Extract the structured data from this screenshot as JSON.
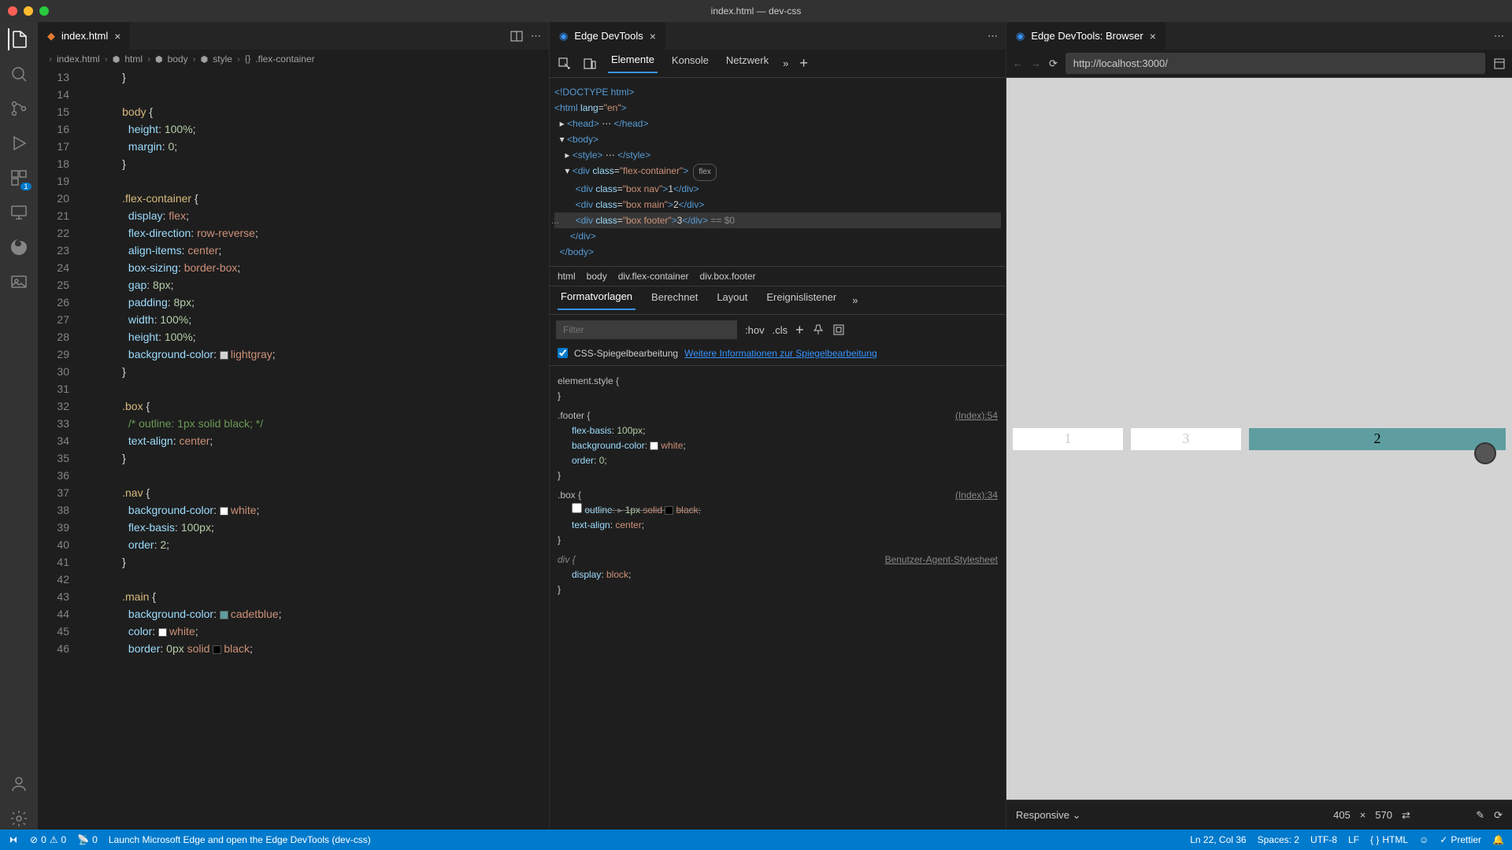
{
  "window": {
    "title": "index.html — dev-css"
  },
  "activity": {
    "badge": "1"
  },
  "editor": {
    "tab": "index.html",
    "breadcrumb": [
      "index.html",
      "html",
      "body",
      "style",
      ".flex-container"
    ],
    "lines": [
      {
        "n": 13,
        "html": "        <span class='punc'>}</span>"
      },
      {
        "n": 14,
        "html": ""
      },
      {
        "n": 15,
        "html": "        <span class='sel'>body</span> <span class='punc'>{</span>"
      },
      {
        "n": 16,
        "html": "          <span class='prop'>height</span>: <span class='num'>100%</span>;"
      },
      {
        "n": 17,
        "html": "          <span class='prop'>margin</span>: <span class='num'>0</span>;"
      },
      {
        "n": 18,
        "html": "        <span class='punc'>}</span>"
      },
      {
        "n": 19,
        "html": ""
      },
      {
        "n": 20,
        "html": "        <span class='sel'>.flex-container</span> <span class='punc'>{</span>"
      },
      {
        "n": 21,
        "html": "          <span class='prop'>display</span>: <span class='val'>flex</span>;"
      },
      {
        "n": 22,
        "html": "          <span class='prop'>flex-direction</span>: <span class='val'>row-reverse</span>;"
      },
      {
        "n": 23,
        "html": "          <span class='prop'>align-items</span>: <span class='val'>center</span>;"
      },
      {
        "n": 24,
        "html": "          <span class='prop'>box-sizing</span>: <span class='val'>border-box</span>;"
      },
      {
        "n": 25,
        "html": "          <span class='prop'>gap</span>: <span class='num'>8px</span>;"
      },
      {
        "n": 26,
        "html": "          <span class='prop'>padding</span>: <span class='num'>8px</span>;"
      },
      {
        "n": 27,
        "html": "          <span class='prop'>width</span>: <span class='num'>100%</span>;"
      },
      {
        "n": 28,
        "html": "          <span class='prop'>height</span>: <span class='num'>100%</span>;"
      },
      {
        "n": 29,
        "html": "          <span class='prop'>background-color</span>: <span class='sw' style='background:#d3d3d3'></span><span class='val'>lightgray</span>;"
      },
      {
        "n": 30,
        "html": "        <span class='punc'>}</span>"
      },
      {
        "n": 31,
        "html": ""
      },
      {
        "n": 32,
        "html": "        <span class='sel'>.box</span> <span class='punc'>{</span>"
      },
      {
        "n": 33,
        "html": "          <span class='cmt'>/* outline: 1px solid black; */</span>"
      },
      {
        "n": 34,
        "html": "          <span class='prop'>text-align</span>: <span class='val'>center</span>;"
      },
      {
        "n": 35,
        "html": "        <span class='punc'>}</span>"
      },
      {
        "n": 36,
        "html": ""
      },
      {
        "n": 37,
        "html": "        <span class='sel'>.nav</span> <span class='punc'>{</span>"
      },
      {
        "n": 38,
        "html": "          <span class='prop'>background-color</span>: <span class='sw' style='background:#fff'></span><span class='val'>white</span>;"
      },
      {
        "n": 39,
        "html": "          <span class='prop'>flex-basis</span>: <span class='num'>100px</span>;"
      },
      {
        "n": 40,
        "html": "          <span class='prop'>order</span>: <span class='num'>2</span>;"
      },
      {
        "n": 41,
        "html": "        <span class='punc'>}</span>"
      },
      {
        "n": 42,
        "html": ""
      },
      {
        "n": 43,
        "html": "        <span class='sel'>.main</span> <span class='punc'>{</span>"
      },
      {
        "n": 44,
        "html": "          <span class='prop'>background-color</span>: <span class='sw' style='background:#5f9ea0'></span><span class='val'>cadetblue</span>;"
      },
      {
        "n": 45,
        "html": "          <span class='prop'>color</span>: <span class='sw' style='background:#fff'></span><span class='val'>white</span>;"
      },
      {
        "n": 46,
        "html": "          <span class='prop'>border</span>: <span class='num'>0px</span> <span class='val'>solid</span> <span class='sw' style='background:#000'></span><span class='val'>black</span>;"
      }
    ]
  },
  "devtools": {
    "tab": "Edge DevTools",
    "tabs": [
      "Elemente",
      "Konsole",
      "Netzwerk"
    ],
    "dom": [
      {
        "i": 0,
        "html": "<span class='tag'>&lt;!DOCTYPE html&gt;</span>"
      },
      {
        "i": 0,
        "html": "<span class='tag'>&lt;html</span> <span class='attr'>lang</span>=<span class='str'>\"en\"</span><span class='tag'>&gt;</span>"
      },
      {
        "i": 1,
        "html": "▸ <span class='tag'>&lt;head&gt;</span> ⋯ <span class='tag'>&lt;/head&gt;</span>"
      },
      {
        "i": 1,
        "html": "▾ <span class='tag'>&lt;body&gt;</span>"
      },
      {
        "i": 2,
        "html": "▸ <span class='tag'>&lt;style&gt;</span> ⋯ <span class='tag'>&lt;/style&gt;</span>"
      },
      {
        "i": 2,
        "html": "▾ <span class='tag'>&lt;div</span> <span class='attr'>class</span>=<span class='str'>\"flex-container\"</span><span class='tag'>&gt;</span><span class='pill'>flex</span>"
      },
      {
        "i": 3,
        "html": "  <span class='tag'>&lt;div</span> <span class='attr'>class</span>=<span class='str'>\"box nav\"</span><span class='tag'>&gt;</span>1<span class='tag'>&lt;/div&gt;</span>"
      },
      {
        "i": 3,
        "html": "  <span class='tag'>&lt;div</span> <span class='attr'>class</span>=<span class='str'>\"box main\"</span><span class='tag'>&gt;</span>2<span class='tag'>&lt;/div&gt;</span>"
      },
      {
        "i": 3,
        "html": "  <span class='tag'>&lt;div</span> <span class='attr'>class</span>=<span class='str'>\"box footer\"</span><span class='tag'>&gt;</span>3<span class='tag'>&lt;/div&gt;</span> <span style='color:#888'>== $0</span>",
        "hl": true
      },
      {
        "i": 2,
        "html": "  <span class='tag'>&lt;/div&gt;</span>"
      },
      {
        "i": 1,
        "html": "<span class='tag'>&lt;/body&gt;</span>"
      }
    ],
    "path": [
      "html",
      "body",
      "div.flex-container",
      "div.box.footer"
    ],
    "styles_tabs": [
      "Formatvorlagen",
      "Berechnet",
      "Layout",
      "Ereignislistener"
    ],
    "filter_placeholder": "Filter",
    "hov": ":hov",
    "cls": ".cls",
    "mirror_label": "CSS-Spiegelbearbeitung",
    "mirror_link": "Weitere Informationen zur Spiegelbearbeitung",
    "rules": [
      {
        "sel": "element.style {",
        "src": "",
        "body": [],
        "close": "}"
      },
      {
        "sel": ".footer {",
        "src": "(Index):54",
        "body": [
          "<span class='prop'>flex-basis</span>: <span class='num'>100px</span>;",
          "<span class='prop'>background-color</span>: <span class='sw' style='background:#fff'></span><span class='val'>white</span>;",
          "<span class='prop'>order</span>: <span class='num'>0</span>;"
        ],
        "close": "}"
      },
      {
        "sel": ".box {",
        "src": "(Index):34",
        "body": [
          "<input type='checkbox' class='cb'> <span class='struck'><span class='prop'>outline</span>: ▸ <span class='num'>1px</span> <span class='val'>solid</span> <span class='sw' style='background:#000'></span><span class='val'>black</span>;</span>",
          "<span class='prop'>text-align</span>: <span class='val'>center</span>;"
        ],
        "close": "}"
      },
      {
        "sel": "div {",
        "src": "Benutzer-Agent-Stylesheet",
        "italic": true,
        "body": [
          "<span class='prop'>display</span>: <span class='val'>block</span>;"
        ],
        "close": "}"
      }
    ]
  },
  "browser": {
    "tab": "Edge DevTools: Browser",
    "url": "http://localhost:3000/",
    "boxes": [
      "1",
      "3",
      "2"
    ],
    "device": "Responsive",
    "w": "405",
    "h": "570",
    "x_sep": "×"
  },
  "status": {
    "remote": "0",
    "errors": "0",
    "warnings": "0",
    "port": "0",
    "launch": "Launch Microsoft Edge and open the Edge DevTools (dev-css)",
    "pos": "Ln 22, Col 36",
    "spaces": "Spaces: 2",
    "enc": "UTF-8",
    "eol": "LF",
    "lang": "HTML",
    "prettier": "Prettier"
  }
}
